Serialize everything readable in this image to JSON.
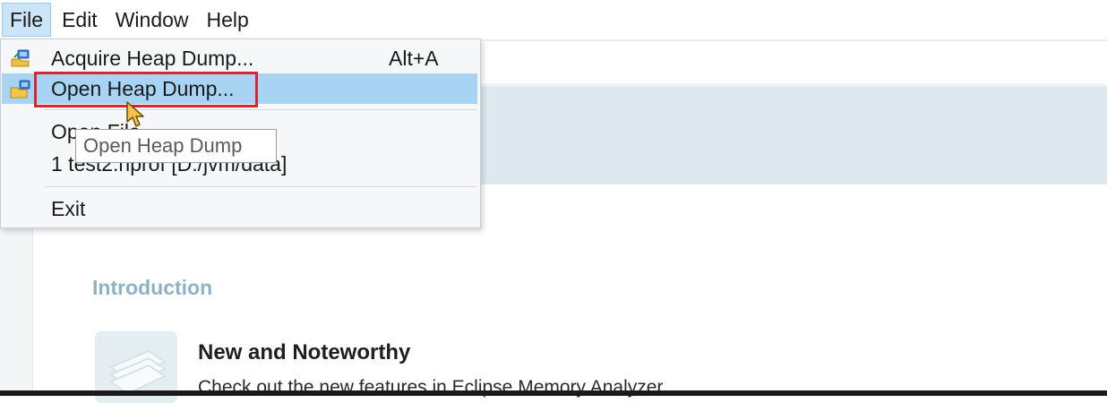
{
  "menubar": {
    "items": [
      "File",
      "Edit",
      "Window",
      "Help"
    ],
    "active": "File"
  },
  "file_menu": {
    "items": [
      {
        "label": "Acquire Heap Dump...",
        "shortcut": "Alt+A",
        "icon": "acquire-heap-icon"
      },
      {
        "label": "Open Heap Dump...",
        "shortcut": "",
        "icon": "open-folder-icon",
        "highlighted": true
      },
      {
        "label": "Open File...",
        "shortcut": ""
      },
      {
        "label": "1  test2.hprof  [D:/jvm/data]",
        "shortcut": ""
      },
      {
        "label": "Exit",
        "shortcut": ""
      }
    ]
  },
  "tooltip": {
    "text": "Open Heap Dump"
  },
  "welcome": {
    "intro_heading": "Introduction",
    "feature_title": "New and Noteworthy",
    "feature_desc": "Check out the new features in Eclipse Memory Analyzer"
  },
  "colors": {
    "highlight": "#a9d3f2",
    "menu_active": "#cce4f7",
    "annotation_red": "#d8262f",
    "intro_heading": "#8fb1c6"
  }
}
